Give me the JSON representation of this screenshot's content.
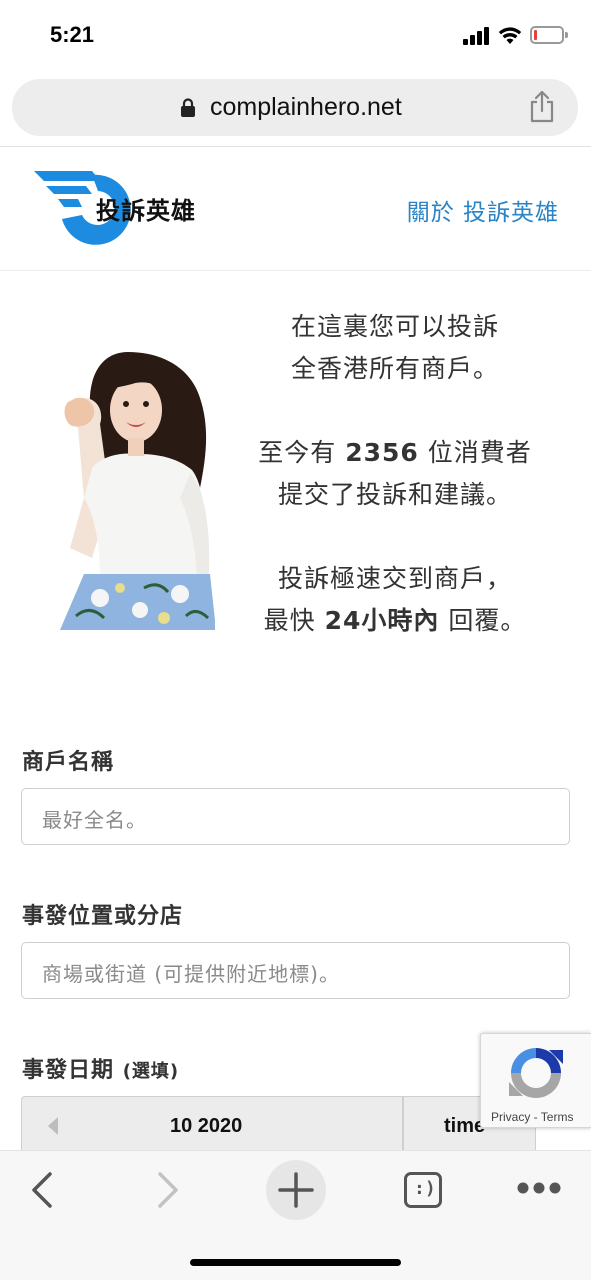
{
  "status_bar": {
    "time": "5:21",
    "battery_level": 0.1,
    "battery_color": "#e2423a"
  },
  "browser": {
    "url": "complainhero.net",
    "lock_icon": "lock-icon",
    "share_icon": "share-icon"
  },
  "site": {
    "logo_text": "投訴英雄",
    "nav_about": "關於 投訴英雄",
    "brand_color": "#1d8be0",
    "link_color": "#2b84c6"
  },
  "hero": {
    "line1": "在這裏您可以投訴",
    "line2": "全香港所有商戶。",
    "line3_pre": "至今有 ",
    "line3_count": "2356",
    "line3_post": " 位消費者",
    "line4": "提交了投訴和建議。",
    "line5": "投訴極速交到商戶，",
    "line6_pre": "最快 ",
    "line6_bold": "24小時內",
    "line6_post": " 回覆。"
  },
  "form": {
    "merchant_label": "商戶名稱",
    "merchant_placeholder": "最好全名。",
    "location_label": "事發位置或分店",
    "location_placeholder": "商場或街道 (可提供附近地標)。",
    "date_label": "事發日期",
    "date_optional": "(選填)",
    "date_picker": {
      "month": "10 2020",
      "time": "time"
    }
  },
  "recaptcha": {
    "privacy": "Privacy",
    "separator": " - ",
    "terms": "Terms"
  },
  "toolbar": {
    "back_icon": "back-icon",
    "forward_icon": "forward-icon",
    "new_tab_icon": "plus-icon",
    "tabs_icon": "tab-switcher-icon",
    "tabs_label": ":)",
    "menu_icon": "more-icon"
  }
}
